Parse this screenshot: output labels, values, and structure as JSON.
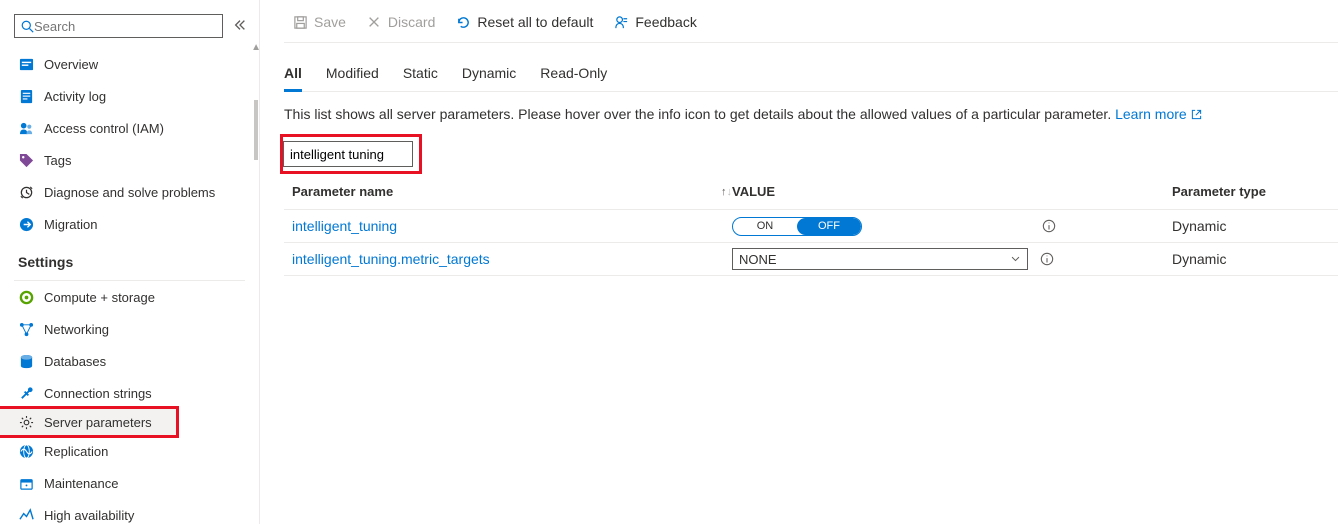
{
  "sidebar": {
    "search_placeholder": "Search",
    "items": [
      {
        "label": "Overview",
        "icon": "overview"
      },
      {
        "label": "Activity log",
        "icon": "activity"
      },
      {
        "label": "Access control (IAM)",
        "icon": "iam"
      },
      {
        "label": "Tags",
        "icon": "tag"
      },
      {
        "label": "Diagnose and solve problems",
        "icon": "diagnose"
      },
      {
        "label": "Migration",
        "icon": "migration"
      }
    ],
    "section_header": "Settings",
    "settings_items": [
      {
        "label": "Compute + storage",
        "icon": "compute"
      },
      {
        "label": "Networking",
        "icon": "network"
      },
      {
        "label": "Databases",
        "icon": "database"
      },
      {
        "label": "Connection strings",
        "icon": "connection"
      },
      {
        "label": "Server parameters",
        "icon": "gear",
        "active": true,
        "highlight": true
      },
      {
        "label": "Replication",
        "icon": "globe"
      },
      {
        "label": "Maintenance",
        "icon": "maintenance"
      },
      {
        "label": "High availability",
        "icon": "ha"
      }
    ]
  },
  "toolbar": {
    "save_label": "Save",
    "discard_label": "Discard",
    "reset_label": "Reset all to default",
    "feedback_label": "Feedback"
  },
  "tabs": [
    "All",
    "Modified",
    "Static",
    "Dynamic",
    "Read-Only"
  ],
  "active_tab": "All",
  "info_text": "This list shows all server parameters. Please hover over the info icon to get details about the allowed values of a particular parameter. ",
  "learn_more": "Learn more",
  "filter_value": "intelligent tuning",
  "columns": {
    "name": "Parameter name",
    "value": "VALUE",
    "type": "Parameter type"
  },
  "rows": [
    {
      "name": "intelligent_tuning",
      "control": "toggle",
      "on": "ON",
      "off": "OFF",
      "selected": "OFF",
      "type": "Dynamic"
    },
    {
      "name": "intelligent_tuning.metric_targets",
      "control": "select",
      "value": "NONE",
      "type": "Dynamic"
    }
  ]
}
